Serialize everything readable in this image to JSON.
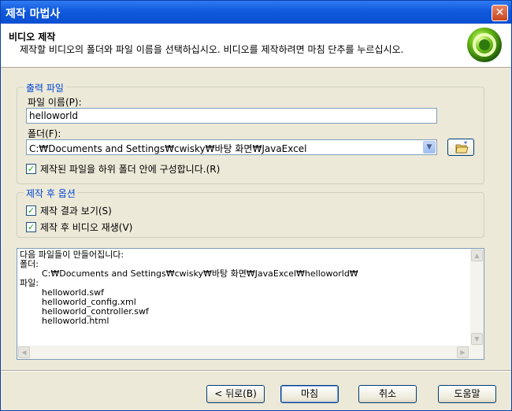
{
  "window": {
    "title": "제작 마법사"
  },
  "header": {
    "title": "비디오 제작",
    "description": "제작할 비디오의 폴더와 파일 이름을 선택하십시오. 비디오를 제작하려면 마침 단추를 누르십시오."
  },
  "output_group": {
    "label": "출력 파일",
    "filename_label": "파일 이름(P):",
    "filename_value": "helloworld",
    "folder_label": "폴더(F):",
    "folder_value": "C:₩Documents and Settings₩cwisky₩바탕 화면₩JavaExcel",
    "subfolder_checkbox": {
      "label": "제작된 파일을 하위 폴더 안에 구성합니다.(R)",
      "checked": true
    }
  },
  "post_group": {
    "label": "제작 후 옵션",
    "view_results": {
      "label": "제작 결과 보기(S)",
      "checked": true
    },
    "play_video": {
      "label": "제작 후 비디오 재생(V)",
      "checked": true
    }
  },
  "summary": {
    "text": "다음 파일들이 만들어집니다:\n폴더:\n        C:₩Documents and Settings₩cwisky₩바탕 화면₩JavaExcel₩helloworld₩\n파일:\n        helloworld.swf\n        helloworld_config.xml\n        helloworld_controller.swf\n        helloworld.html"
  },
  "buttons": {
    "back": "< 뒤로(B)",
    "finish": "마침",
    "cancel": "취소",
    "help": "도움말"
  },
  "colors": {
    "titlebar": "#0a4fd0",
    "group_label": "#0046d5",
    "check": "#21a121"
  }
}
